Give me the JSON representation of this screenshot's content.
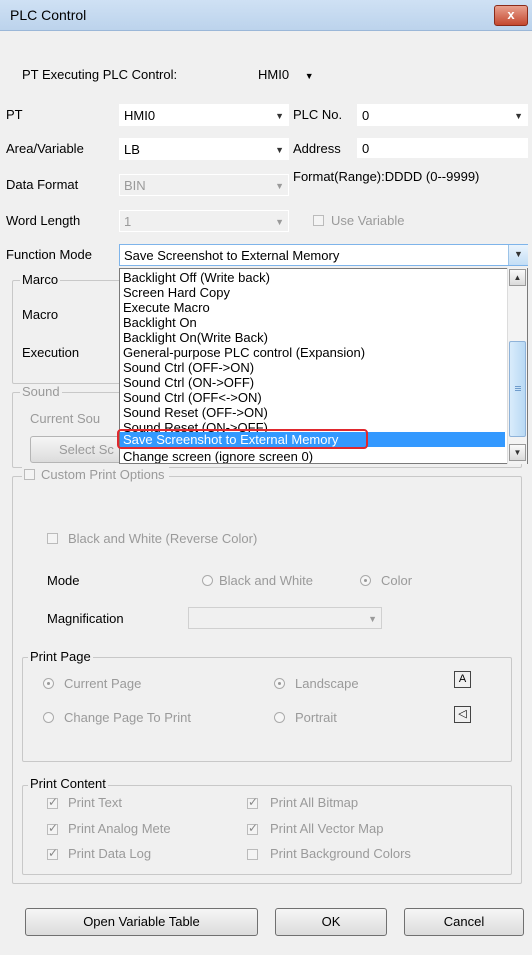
{
  "window": {
    "title": "PLC Control",
    "close_label": "x"
  },
  "pt_executing": {
    "label": "PT Executing PLC Control:",
    "value": "HMI0"
  },
  "pt": {
    "label": "PT",
    "value": "HMI0"
  },
  "plc_no": {
    "label": "PLC No.",
    "value": "0"
  },
  "area": {
    "label": "Area/Variable",
    "value": "LB"
  },
  "address": {
    "label": "Address",
    "value": "0"
  },
  "data_format": {
    "label": "Data Format",
    "value": "BIN",
    "range_text": "Format(Range):DDDD (0--9999)"
  },
  "word_length": {
    "label": "Word Length",
    "value": "1",
    "use_variable": "Use Variable"
  },
  "function_mode": {
    "label": "Function Mode",
    "value": "Save Screenshot to External Memory",
    "options": [
      "Backlight Off (Write back)",
      "Screen Hard Copy",
      "Execute Macro",
      "Backlight On",
      "Backlight On(Write Back)",
      "General-purpose PLC control (Expansion)",
      "Sound Ctrl (OFF->ON)",
      "Sound Ctrl (ON->OFF)",
      "Sound Ctrl (OFF<->ON)",
      "Sound Reset (OFF->ON)",
      "Sound Reset (ON->OFF)",
      "Save Screenshot to External Memory",
      "Change screen (ignore screen 0)"
    ],
    "selected_index": 11
  },
  "macro_group": {
    "title": "Marco",
    "macro_label": "Macro",
    "execution_label": "Execution"
  },
  "sound_group": {
    "title": "Sound",
    "current_sound_label": "Current Sou",
    "select_button": "Select Sc"
  },
  "print_options": {
    "title": "Custom Print Options",
    "black_white_reverse": "Black and White (Reverse Color)",
    "mode_label": "Mode",
    "mode_bw": "Black and White",
    "mode_color": "Color",
    "magnification_label": "Magnification",
    "print_page": {
      "title": "Print Page",
      "current_page": "Current Page",
      "landscape": "Landscape",
      "change_page": "Change Page To Print",
      "portrait": "Portrait",
      "landscape_icon": "A",
      "portrait_icon": "◁"
    },
    "print_content": {
      "title": "Print Content",
      "print_text": "Print Text",
      "print_all_bitmap": "Print All Bitmap",
      "print_analog": "Print Analog Mete",
      "print_vector": "Print All Vector Map",
      "print_data_log": "Print Data Log",
      "print_bg_colors": "Print Background Colors"
    }
  },
  "buttons": {
    "open_table": "Open Variable Table",
    "ok": "OK",
    "cancel": "Cancel"
  },
  "colors": {
    "selection": "#3399ff",
    "highlight_border": "#e0282e",
    "close_button": "#c4482f"
  }
}
